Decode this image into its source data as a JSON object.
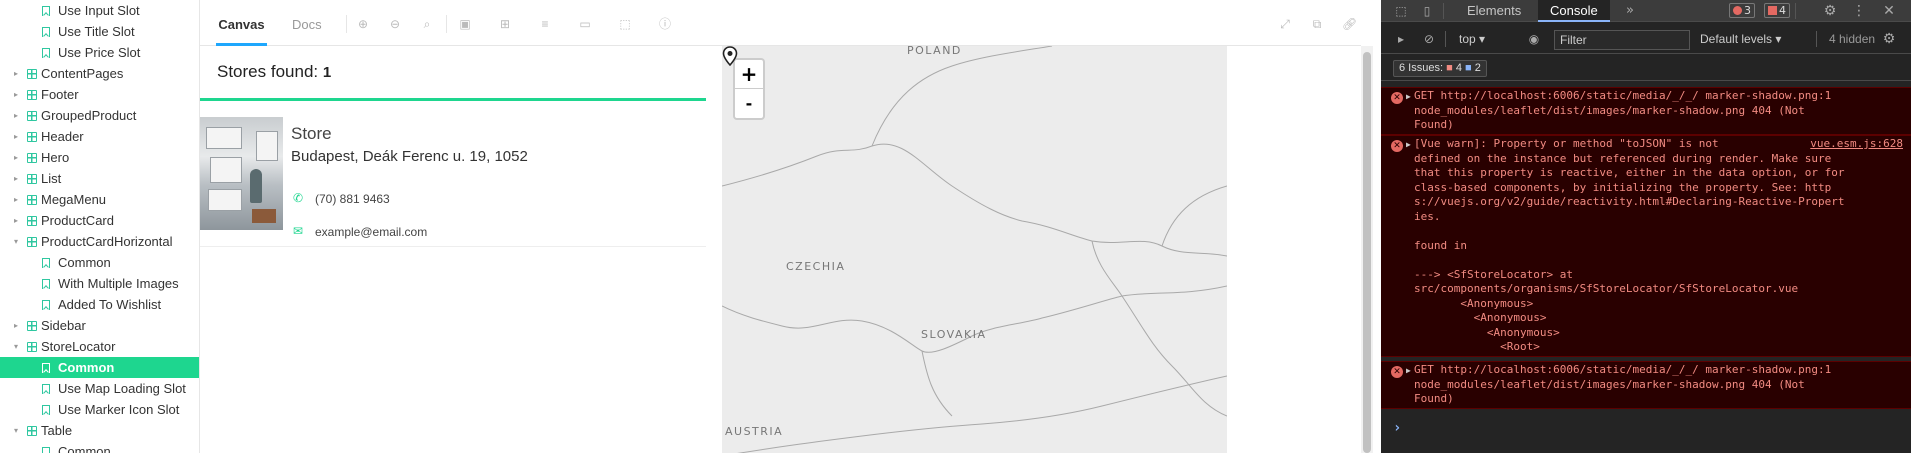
{
  "sidebar": {
    "items": [
      {
        "label": "Use Input Slot",
        "level": 1,
        "type": "story"
      },
      {
        "label": "Use Title Slot",
        "level": 1,
        "type": "story"
      },
      {
        "label": "Use Price Slot",
        "level": 1,
        "type": "story"
      },
      {
        "label": "ContentPages",
        "level": 0,
        "type": "component"
      },
      {
        "label": "Footer",
        "level": 0,
        "type": "component"
      },
      {
        "label": "GroupedProduct",
        "level": 0,
        "type": "component"
      },
      {
        "label": "Header",
        "level": 0,
        "type": "component"
      },
      {
        "label": "Hero",
        "level": 0,
        "type": "component"
      },
      {
        "label": "List",
        "level": 0,
        "type": "component"
      },
      {
        "label": "MegaMenu",
        "level": 0,
        "type": "component"
      },
      {
        "label": "ProductCard",
        "level": 0,
        "type": "component"
      },
      {
        "label": "ProductCardHorizontal",
        "level": 0,
        "type": "component",
        "expanded": true
      },
      {
        "label": "Common",
        "level": 1,
        "type": "story"
      },
      {
        "label": "With Multiple Images",
        "level": 1,
        "type": "story"
      },
      {
        "label": "Added To Wishlist",
        "level": 1,
        "type": "story"
      },
      {
        "label": "Sidebar",
        "level": 0,
        "type": "component"
      },
      {
        "label": "StoreLocator",
        "level": 0,
        "type": "component",
        "expanded": true
      },
      {
        "label": "Common",
        "level": 1,
        "type": "story",
        "selected": true
      },
      {
        "label": "Use Map Loading Slot",
        "level": 1,
        "type": "story"
      },
      {
        "label": "Use Marker Icon Slot",
        "level": 1,
        "type": "story"
      },
      {
        "label": "Table",
        "level": 0,
        "type": "component",
        "expanded": true
      },
      {
        "label": "Common",
        "level": 1,
        "type": "story"
      }
    ]
  },
  "toolbar": {
    "tab_canvas": "Canvas",
    "tab_docs": "Docs"
  },
  "stores": {
    "found_label": "Stores found:",
    "found_count": "1",
    "store": {
      "name": "Store",
      "address": "Budapest, Deák Ferenc u. 19, 1052",
      "phone": "(70) 881 9463",
      "email": "example@email.com"
    }
  },
  "map": {
    "zoom_in": "+",
    "zoom_out": "-",
    "countries": [
      "POLAND",
      "CZECHIA",
      "SLOVAKIA",
      "AUSTRIA"
    ]
  },
  "devtools": {
    "tabs": [
      "Elements",
      "Console"
    ],
    "more_tabs": "»",
    "error_count": "3",
    "warning_count": "4",
    "context": "top",
    "filter_placeholder": "Filter",
    "levels": "Default levels",
    "hidden": "4 hidden",
    "issues_label": "6 Issues:",
    "issues_errors": "4",
    "issues_info": "2",
    "messages": [
      {
        "lines": [
          "GET http://localhost:6006/static/media/_/_/ marker-shadow.png:1",
          "node_modules/leaflet/dist/images/marker-shadow.png 404 (Not",
          "Found)"
        ]
      },
      {
        "source": "vue.esm.js:628",
        "lines": [
          "[Vue warn]: Property or method \"toJSON\" is not",
          "defined on the instance but referenced during render. Make sure",
          "that this property is reactive, either in the data option, or for",
          "class-based components, by initializing the property. See: http",
          "s://vuejs.org/v2/guide/reactivity.html#Declaring-Reactive-Propert",
          "ies.",
          "",
          "found in",
          "",
          "---> <SfStoreLocator> at",
          "src/components/organisms/SfStoreLocator/SfStoreLocator.vue",
          "       <Anonymous>",
          "         <Anonymous>",
          "           <Anonymous>",
          "             <Root>"
        ]
      },
      {
        "lines": [
          "GET http://localhost:6006/static/media/_/_/ marker-shadow.png:1",
          "node_modules/leaflet/dist/images/marker-shadow.png 404 (Not",
          "Found)"
        ]
      }
    ],
    "prompt": "›"
  }
}
